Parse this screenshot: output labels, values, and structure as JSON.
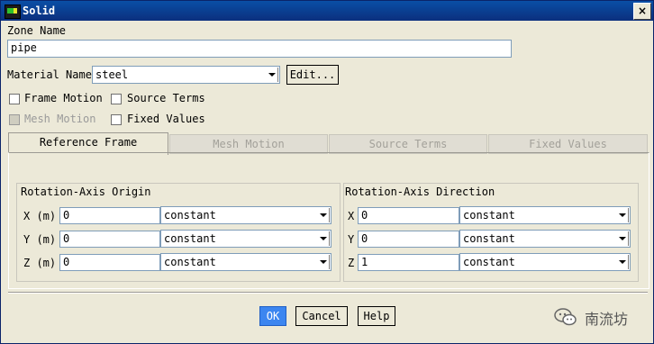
{
  "window": {
    "title": "Solid",
    "close_label": "×"
  },
  "zone": {
    "label": "Zone Name",
    "value": "pipe"
  },
  "material": {
    "label": "Material Name",
    "value": "steel",
    "edit_label": "Edit..."
  },
  "options": {
    "frame_motion": "Frame Motion",
    "source_terms": "Source Terms",
    "mesh_motion": "Mesh Motion",
    "fixed_values": "Fixed Values"
  },
  "tabs": [
    {
      "label": "Reference Frame"
    },
    {
      "label": "Mesh Motion"
    },
    {
      "label": "Source Terms"
    },
    {
      "label": "Fixed Values"
    }
  ],
  "origin": {
    "title": "Rotation-Axis Origin",
    "rows": [
      {
        "label": "X (m)",
        "value": "0",
        "method": "constant"
      },
      {
        "label": "Y (m)",
        "value": "0",
        "method": "constant"
      },
      {
        "label": "Z (m)",
        "value": "0",
        "method": "constant"
      }
    ]
  },
  "direction": {
    "title": "Rotation-Axis Direction",
    "rows": [
      {
        "label": "X",
        "value": "0",
        "method": "constant"
      },
      {
        "label": "Y",
        "value": "0",
        "method": "constant"
      },
      {
        "label": "Z",
        "value": "1",
        "method": "constant"
      }
    ]
  },
  "buttons": {
    "ok": "OK",
    "cancel": "Cancel",
    "help": "Help"
  },
  "watermark": {
    "text": "南流坊",
    "icon": "wechat-icon"
  }
}
